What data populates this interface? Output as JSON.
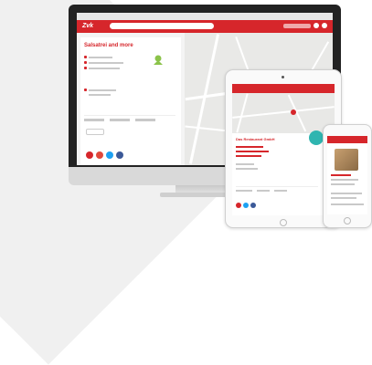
{
  "desktop": {
    "logo": "Zvk",
    "search_placeholder": "",
    "title": "Salsatrei and more",
    "breadcrumb": ""
  },
  "tablet": {
    "title": "Das Restaurant GmbH"
  },
  "phone": {
    "title": ""
  },
  "colors": {
    "brand": "#d6262b",
    "accent": "#2fb5b0",
    "facebook": "#3b5998",
    "twitter": "#1da1f2",
    "google": "#d6262b"
  }
}
